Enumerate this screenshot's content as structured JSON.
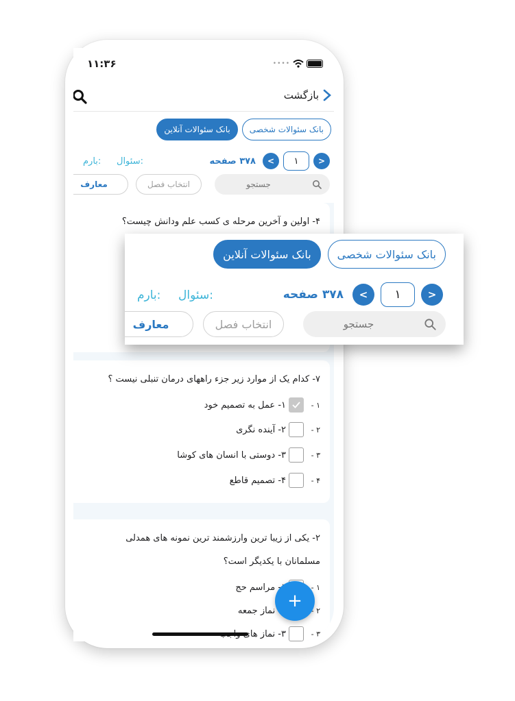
{
  "status": {
    "time": "۱۱:۳۶"
  },
  "nav": {
    "back_label": "بازگشت"
  },
  "tabs": {
    "personal": "بانک سئوالات شخصی",
    "online": "بانک سئوالات آنلاین"
  },
  "pager": {
    "next": ">",
    "prev": "<",
    "current_page": "۱",
    "pages_text": "۳۷۸ صفحه"
  },
  "labels": {
    "question": "سئوال:",
    "score": "بارم:"
  },
  "filters": {
    "search_placeholder": "جستجو",
    "chapter": "انتخاب فصل",
    "subject": "معارف"
  },
  "questions": [
    {
      "text": "۴- اولین و آخرین مرحله ی کسب علم ودانش چیست؟",
      "options": []
    },
    {
      "text": "۷- کدام یک از موارد زیر جزء راههای درمان تنبلی نیست ؟",
      "options": [
        {
          "num": "۱ -",
          "label": "۱- عمل به تصمیم خود",
          "checked": true
        },
        {
          "num": "۲ -",
          "label": "۲- آینده نگری",
          "checked": false
        },
        {
          "num": "۳ -",
          "label": "۳- دوستی با انسان های کوشا",
          "checked": false
        },
        {
          "num": "۴ -",
          "label": "۴- تصمیم قاطع",
          "checked": false
        }
      ]
    },
    {
      "text_line1": "۲- یکی از زیبا ترین وارزشمند ترین نمونه های همدلی",
      "text_line2": "مسلمانان با یکدیگر است؟",
      "options": [
        {
          "num": "۱ -",
          "label": "۱- مراسم حج",
          "checked": false
        },
        {
          "num": "۲ -",
          "label": "۲- نماز جمعه",
          "checked": false
        },
        {
          "num": "۳ -",
          "label": "۳- نماز های واجب",
          "checked": false
        }
      ]
    }
  ],
  "fab": {
    "label": "+"
  },
  "colors": {
    "primary": "#2b79c2",
    "accent_cyan": "#3cb4d8",
    "fab": "#1e8ee8"
  }
}
